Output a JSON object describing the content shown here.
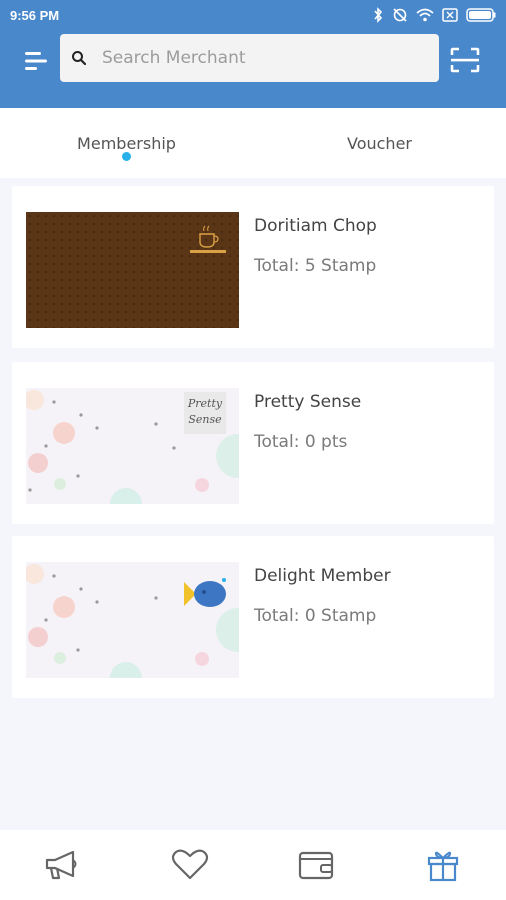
{
  "status_bar": {
    "time": "9:56 PM",
    "icons": [
      "bluetooth-icon",
      "sync-off-icon",
      "wifi-icon",
      "sim-off-icon",
      "battery-icon"
    ]
  },
  "header": {
    "search_placeholder": "Search Merchant",
    "menu_icon": "menu-icon",
    "scan_icon": "scan-icon"
  },
  "tabs": [
    {
      "label": "Membership",
      "active": true
    },
    {
      "label": "Voucher",
      "active": false
    }
  ],
  "memberships": [
    {
      "name": "Doritiam Chop",
      "total": "Total: 5 Stamp"
    },
    {
      "name": "Pretty Sense",
      "total": "Total: 0 pts",
      "logo_text": [
        "Pretty",
        "Sense"
      ]
    },
    {
      "name": "Delight Member",
      "total": "Total: 0 Stamp"
    }
  ],
  "bottom_nav": {
    "items": [
      {
        "icon": "megaphone-icon"
      },
      {
        "icon": "heart-icon"
      },
      {
        "icon": "wallet-icon"
      },
      {
        "icon": "gift-icon",
        "active": true
      }
    ]
  },
  "colors": {
    "primary": "#4a88cc",
    "accent_dot": "#27b0e9",
    "gift_active": "#4a88cc",
    "background": "#f4f6fb"
  }
}
